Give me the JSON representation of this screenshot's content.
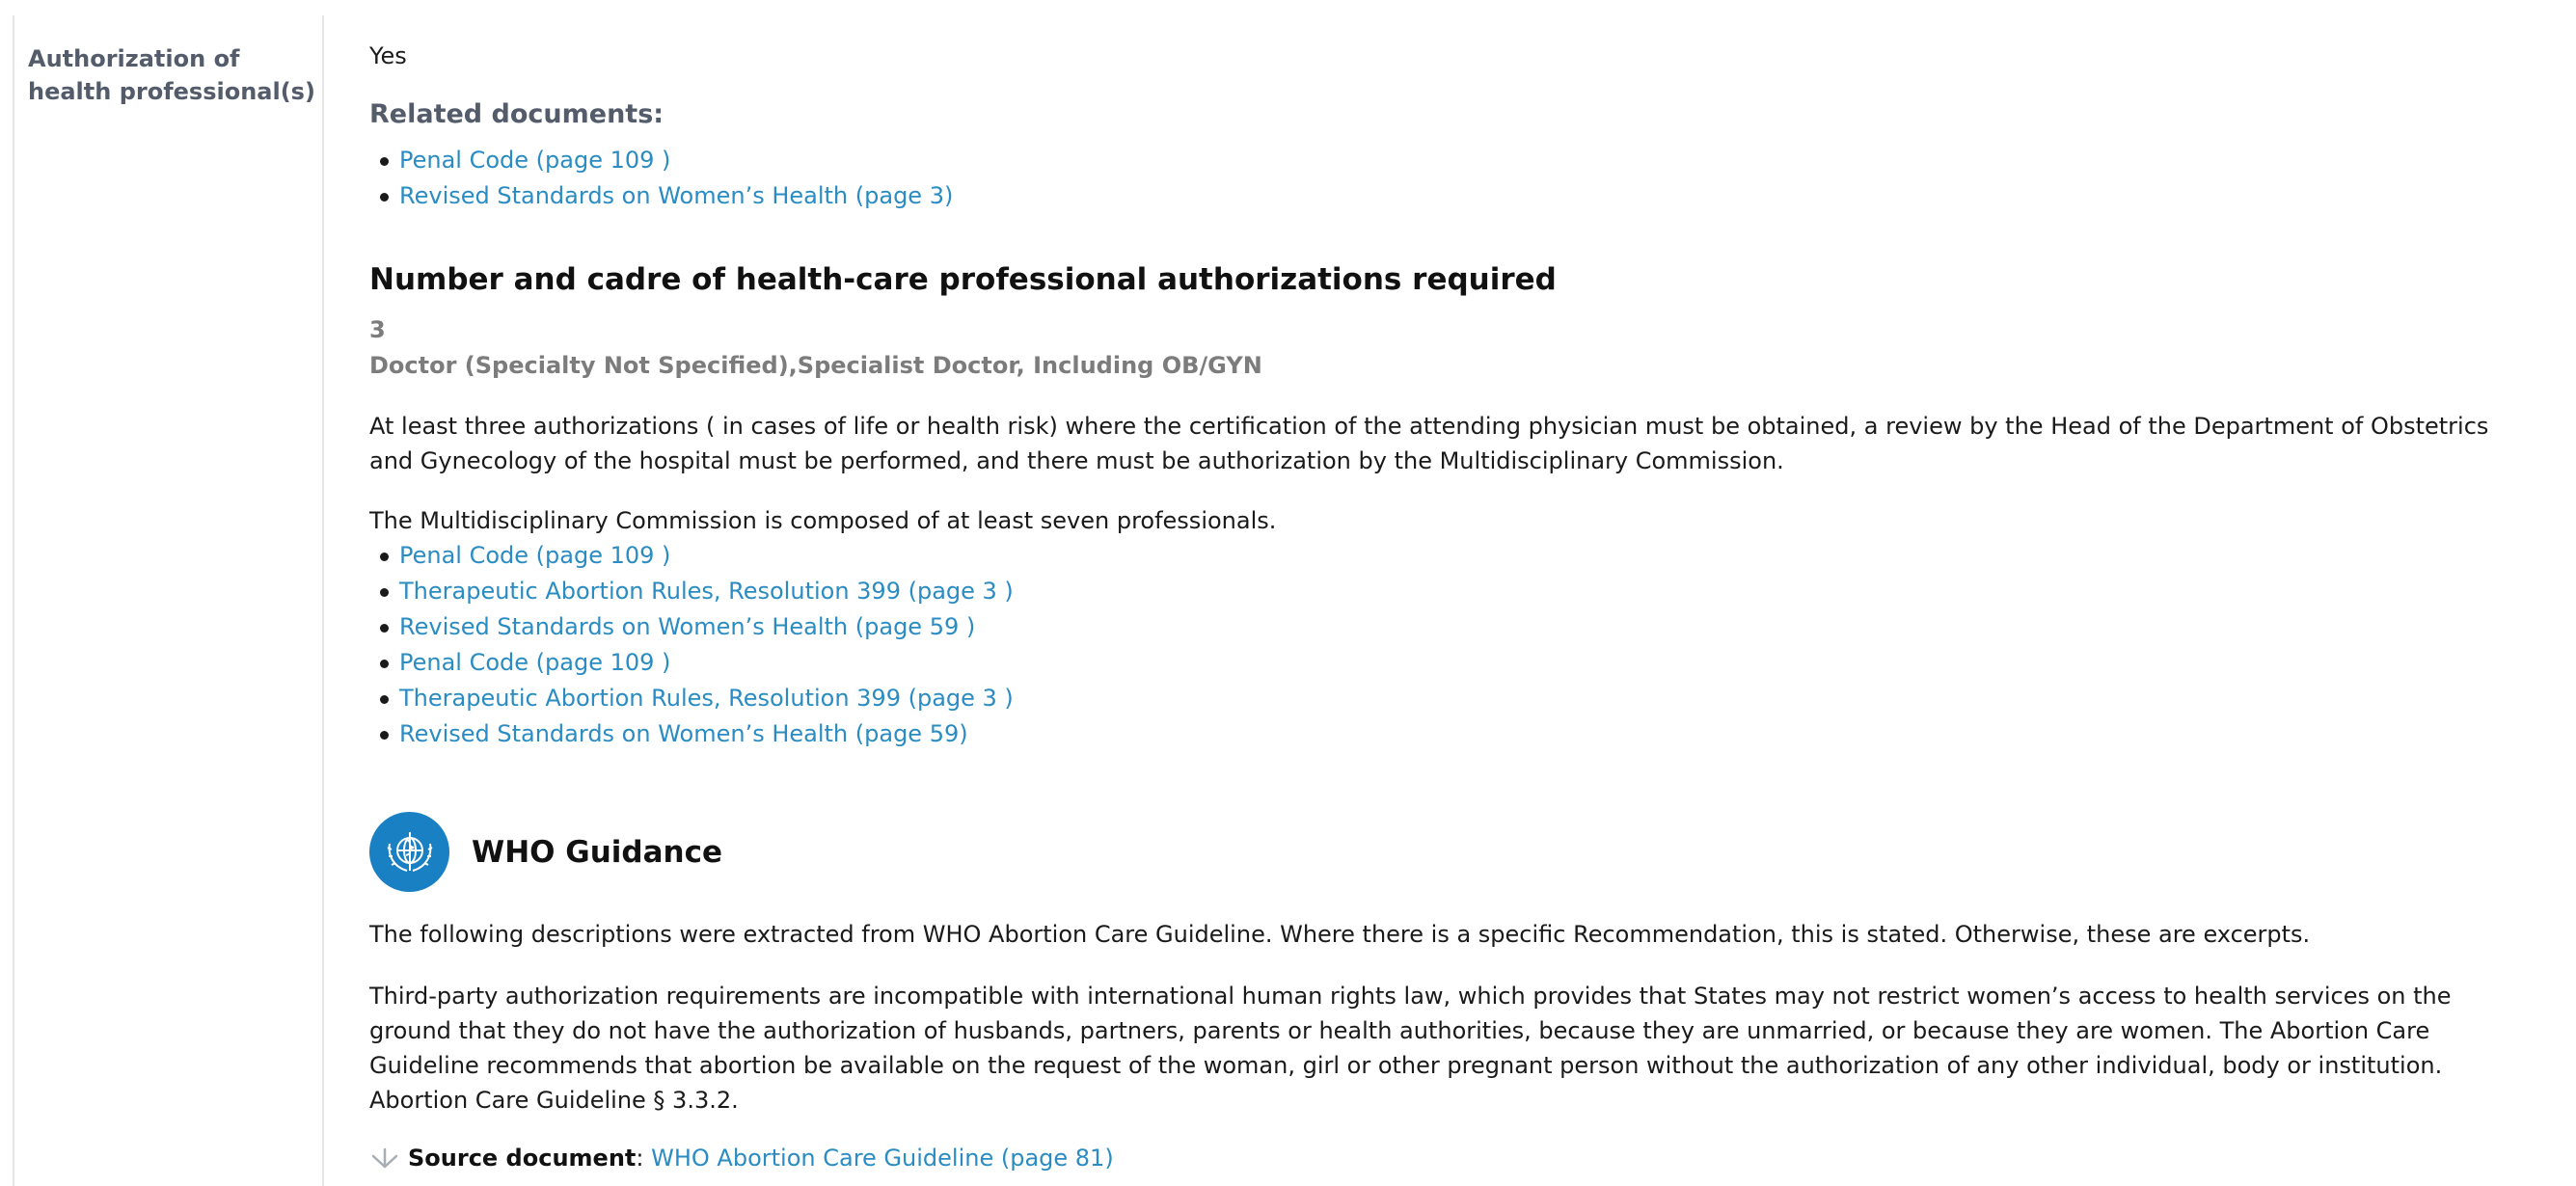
{
  "row": {
    "label": "Authorization of health professional(s)",
    "answer": "Yes"
  },
  "related": {
    "heading": "Related documents:",
    "links": [
      "Penal Code (page 109 )",
      "Revised Standards on Women’s Health (page 3)"
    ]
  },
  "cadre": {
    "title": "Number and cadre of health-care professional authorizations required",
    "number": "3",
    "cadre_text": "Doctor (Specialty Not Specified),Specialist Doctor, Including OB/GYN",
    "paragraph1": "At least three authorizations ( in cases of life or health risk) where the certification of the attending physician must be obtained, a review by the Head of the Department of Obstetrics and Gynecology of the hospital must be performed, and there must be authorization by the Multidisciplinary Commission.",
    "paragraph2": "The Multidisciplinary Commission is composed of at least seven professionals.",
    "links": [
      "Penal Code (page 109 )",
      "Therapeutic Abortion Rules, Resolution 399 (page 3 )",
      "Revised Standards on Women’s Health (page 59 )",
      "Penal Code (page 109 )",
      "Therapeutic Abortion Rules, Resolution 399 (page 3 )",
      "Revised Standards on Women’s Health (page 59)"
    ]
  },
  "who": {
    "logo_icon": "who-emblem-icon",
    "accent_color": "#1a80c4",
    "title": "WHO Guidance",
    "intro": "The following descriptions were extracted from WHO Abortion Care Guideline. Where there is a specific Recommendation, this is stated. Otherwise, these are excerpts.",
    "body": "Third-party authorization requirements are incompatible with international human rights law, which provides that States may not restrict women’s access to health services on the ground that they do not have the authorization of husbands, partners, parents or health authorities, because they are unmarried, or because they are women. The Abortion Care Guideline recommends that abortion be available on the request of the woman, girl or other pregnant person without the authorization of any other individual, body or institution. Abortion Care Guideline § 3.3.2.",
    "source_label": "Source document",
    "source_sep": ":",
    "source_link": "WHO Abortion Care Guideline (page 81)"
  },
  "link_color": "#2a8cc2"
}
